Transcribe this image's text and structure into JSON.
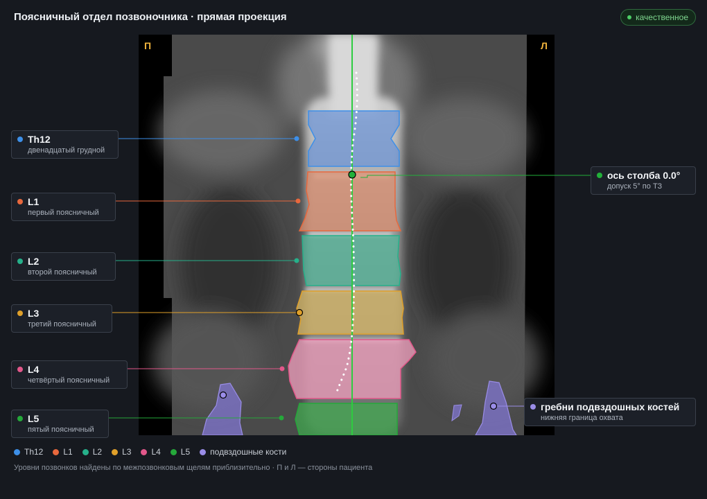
{
  "header": {
    "title": "Поясничный отдел позвоночника · прямая проекция",
    "badge": "качественное"
  },
  "scan": {
    "right_marker": "П",
    "left_marker": "Л"
  },
  "callouts": [
    {
      "id": "th12",
      "name": "Th12",
      "sub": "двенадцатый грудной",
      "color": "#3d8fe8"
    },
    {
      "id": "l1",
      "name": "L1",
      "sub": "первый поясничный",
      "color": "#e8683d"
    },
    {
      "id": "l2",
      "name": "L2",
      "sub": "второй поясничный",
      "color": "#26b08a"
    },
    {
      "id": "l3",
      "name": "L3",
      "sub": "третий поясничный",
      "color": "#e0a02a"
    },
    {
      "id": "l4",
      "name": "L4",
      "sub": "четвёртый поясничный",
      "color": "#e2578a"
    },
    {
      "id": "l5",
      "name": "L5",
      "sub": "пятый поясничный",
      "color": "#25a83a"
    },
    {
      "id": "axis",
      "name": "ось столба 0.0°",
      "sub": "допуск 5° по ТЗ",
      "color": "#22b03a"
    },
    {
      "id": "iliac",
      "name": "гребни подвздошных костей",
      "sub": "нижняя граница охвата",
      "color": "#9a8de8"
    }
  ],
  "legend": [
    {
      "label": "Th12",
      "color": "#3d8fe8"
    },
    {
      "label": "L1",
      "color": "#e8683d"
    },
    {
      "label": "L2",
      "color": "#26b08a"
    },
    {
      "label": "L3",
      "color": "#e0a02a"
    },
    {
      "label": "L4",
      "color": "#e2578a"
    },
    {
      "label": "L5",
      "color": "#25a83a"
    },
    {
      "label": "подвздошные кости",
      "color": "#9a8de8"
    }
  ],
  "footnote": "Уровни позвонков найдены по межпозвонковым щелям приблизительно · П и Л — стороны пациента"
}
